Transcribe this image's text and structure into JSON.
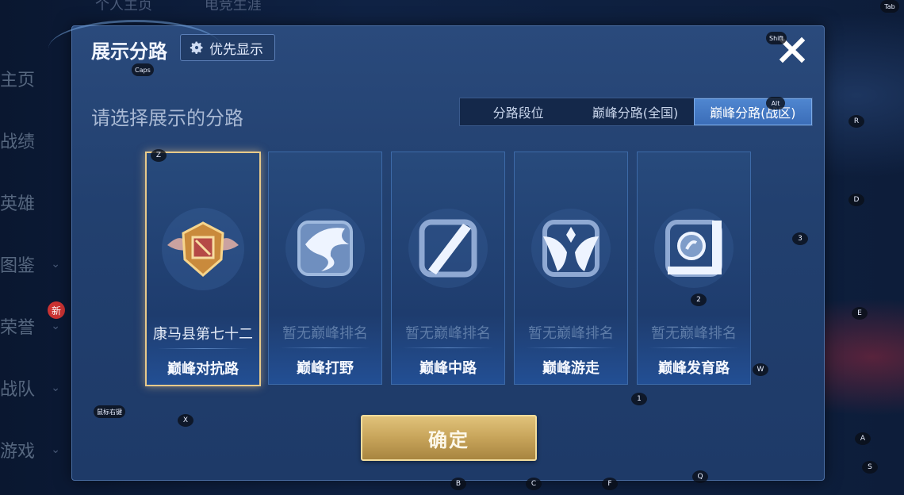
{
  "background": {
    "top_nav": [
      "个人主页",
      "电竞生涯"
    ],
    "side_menu": [
      {
        "label": "主页",
        "chevron": false,
        "new": false
      },
      {
        "label": "战绩",
        "chevron": false,
        "new": false
      },
      {
        "label": "英雄",
        "chevron": false,
        "new": false
      },
      {
        "label": "图鉴",
        "chevron": true,
        "new": false
      },
      {
        "label": "荣誉",
        "chevron": true,
        "new": true
      },
      {
        "label": "战队",
        "chevron": true,
        "new": false
      },
      {
        "label": "游戏",
        "chevron": true,
        "new": false
      }
    ],
    "new_badge": "新"
  },
  "dialog": {
    "title": "展示分路",
    "priority_button": "优先显示",
    "subtitle": "请选择展示的分路",
    "tabs": [
      {
        "label": "分路段位",
        "active": false
      },
      {
        "label": "巅峰分路(全国)",
        "active": false
      },
      {
        "label": "巅峰分路(战区)",
        "active": true
      }
    ],
    "cards": [
      {
        "rank": "康马县第七十二",
        "lane": "巅峰对抗路",
        "selected": true,
        "icon": "clash-lane-badge-icon"
      },
      {
        "rank": "暂无巅峰排名",
        "lane": "巅峰打野",
        "selected": false,
        "icon": "jungle-dragon-icon"
      },
      {
        "rank": "暂无巅峰排名",
        "lane": "巅峰中路",
        "selected": false,
        "icon": "mid-lane-icon"
      },
      {
        "rank": "暂无巅峰排名",
        "lane": "巅峰游走",
        "selected": false,
        "icon": "roam-wings-icon"
      },
      {
        "rank": "暂无巅峰排名",
        "lane": "巅峰发育路",
        "selected": false,
        "icon": "farm-lane-icon"
      }
    ],
    "confirm_button": "确定"
  },
  "key_hints": [
    "Z",
    "Caps",
    "Shift",
    "Alt",
    "R",
    "D",
    "3",
    "2",
    "E",
    "W",
    "1",
    "X",
    "鼠标右键",
    "A",
    "S",
    "B",
    "C",
    "F",
    "Q",
    "Tab"
  ],
  "colors": {
    "accent_gold": "#e7c98a",
    "active_tab": "#4f86d0",
    "dialog_bg": "#22406f"
  }
}
